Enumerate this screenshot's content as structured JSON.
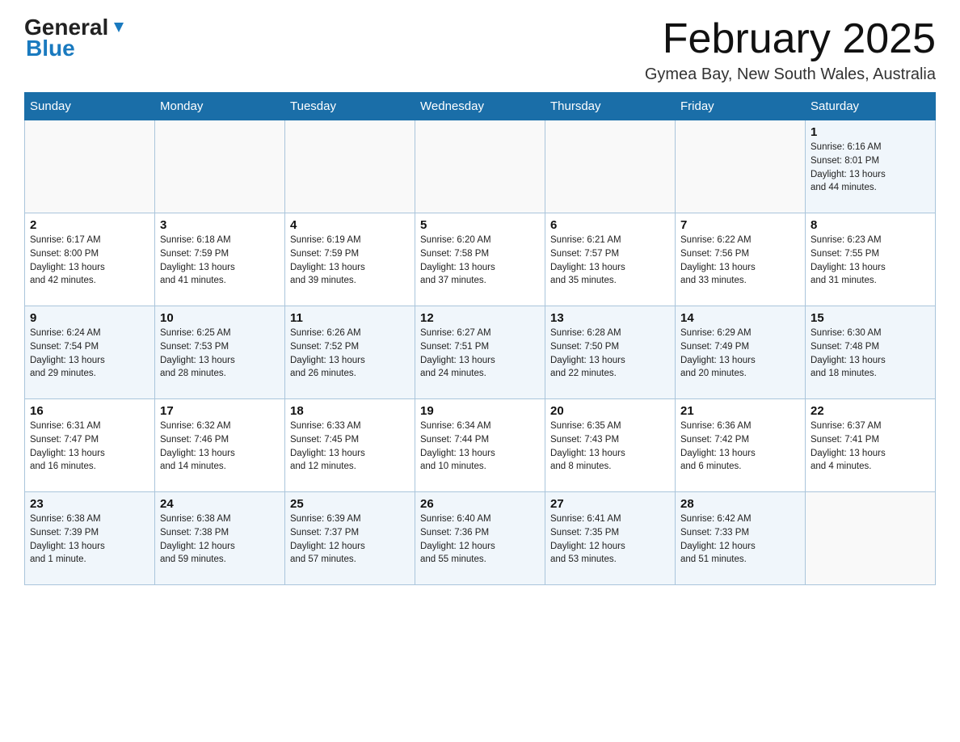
{
  "header": {
    "logo_general": "General",
    "logo_blue": "Blue",
    "month_title": "February 2025",
    "location": "Gymea Bay, New South Wales, Australia"
  },
  "weekdays": [
    "Sunday",
    "Monday",
    "Tuesday",
    "Wednesday",
    "Thursday",
    "Friday",
    "Saturday"
  ],
  "weeks": [
    [
      {
        "day": "",
        "info": ""
      },
      {
        "day": "",
        "info": ""
      },
      {
        "day": "",
        "info": ""
      },
      {
        "day": "",
        "info": ""
      },
      {
        "day": "",
        "info": ""
      },
      {
        "day": "",
        "info": ""
      },
      {
        "day": "1",
        "info": "Sunrise: 6:16 AM\nSunset: 8:01 PM\nDaylight: 13 hours\nand 44 minutes."
      }
    ],
    [
      {
        "day": "2",
        "info": "Sunrise: 6:17 AM\nSunset: 8:00 PM\nDaylight: 13 hours\nand 42 minutes."
      },
      {
        "day": "3",
        "info": "Sunrise: 6:18 AM\nSunset: 7:59 PM\nDaylight: 13 hours\nand 41 minutes."
      },
      {
        "day": "4",
        "info": "Sunrise: 6:19 AM\nSunset: 7:59 PM\nDaylight: 13 hours\nand 39 minutes."
      },
      {
        "day": "5",
        "info": "Sunrise: 6:20 AM\nSunset: 7:58 PM\nDaylight: 13 hours\nand 37 minutes."
      },
      {
        "day": "6",
        "info": "Sunrise: 6:21 AM\nSunset: 7:57 PM\nDaylight: 13 hours\nand 35 minutes."
      },
      {
        "day": "7",
        "info": "Sunrise: 6:22 AM\nSunset: 7:56 PM\nDaylight: 13 hours\nand 33 minutes."
      },
      {
        "day": "8",
        "info": "Sunrise: 6:23 AM\nSunset: 7:55 PM\nDaylight: 13 hours\nand 31 minutes."
      }
    ],
    [
      {
        "day": "9",
        "info": "Sunrise: 6:24 AM\nSunset: 7:54 PM\nDaylight: 13 hours\nand 29 minutes."
      },
      {
        "day": "10",
        "info": "Sunrise: 6:25 AM\nSunset: 7:53 PM\nDaylight: 13 hours\nand 28 minutes."
      },
      {
        "day": "11",
        "info": "Sunrise: 6:26 AM\nSunset: 7:52 PM\nDaylight: 13 hours\nand 26 minutes."
      },
      {
        "day": "12",
        "info": "Sunrise: 6:27 AM\nSunset: 7:51 PM\nDaylight: 13 hours\nand 24 minutes."
      },
      {
        "day": "13",
        "info": "Sunrise: 6:28 AM\nSunset: 7:50 PM\nDaylight: 13 hours\nand 22 minutes."
      },
      {
        "day": "14",
        "info": "Sunrise: 6:29 AM\nSunset: 7:49 PM\nDaylight: 13 hours\nand 20 minutes."
      },
      {
        "day": "15",
        "info": "Sunrise: 6:30 AM\nSunset: 7:48 PM\nDaylight: 13 hours\nand 18 minutes."
      }
    ],
    [
      {
        "day": "16",
        "info": "Sunrise: 6:31 AM\nSunset: 7:47 PM\nDaylight: 13 hours\nand 16 minutes."
      },
      {
        "day": "17",
        "info": "Sunrise: 6:32 AM\nSunset: 7:46 PM\nDaylight: 13 hours\nand 14 minutes."
      },
      {
        "day": "18",
        "info": "Sunrise: 6:33 AM\nSunset: 7:45 PM\nDaylight: 13 hours\nand 12 minutes."
      },
      {
        "day": "19",
        "info": "Sunrise: 6:34 AM\nSunset: 7:44 PM\nDaylight: 13 hours\nand 10 minutes."
      },
      {
        "day": "20",
        "info": "Sunrise: 6:35 AM\nSunset: 7:43 PM\nDaylight: 13 hours\nand 8 minutes."
      },
      {
        "day": "21",
        "info": "Sunrise: 6:36 AM\nSunset: 7:42 PM\nDaylight: 13 hours\nand 6 minutes."
      },
      {
        "day": "22",
        "info": "Sunrise: 6:37 AM\nSunset: 7:41 PM\nDaylight: 13 hours\nand 4 minutes."
      }
    ],
    [
      {
        "day": "23",
        "info": "Sunrise: 6:38 AM\nSunset: 7:39 PM\nDaylight: 13 hours\nand 1 minute."
      },
      {
        "day": "24",
        "info": "Sunrise: 6:38 AM\nSunset: 7:38 PM\nDaylight: 12 hours\nand 59 minutes."
      },
      {
        "day": "25",
        "info": "Sunrise: 6:39 AM\nSunset: 7:37 PM\nDaylight: 12 hours\nand 57 minutes."
      },
      {
        "day": "26",
        "info": "Sunrise: 6:40 AM\nSunset: 7:36 PM\nDaylight: 12 hours\nand 55 minutes."
      },
      {
        "day": "27",
        "info": "Sunrise: 6:41 AM\nSunset: 7:35 PM\nDaylight: 12 hours\nand 53 minutes."
      },
      {
        "day": "28",
        "info": "Sunrise: 6:42 AM\nSunset: 7:33 PM\nDaylight: 12 hours\nand 51 minutes."
      },
      {
        "day": "",
        "info": ""
      }
    ]
  ]
}
